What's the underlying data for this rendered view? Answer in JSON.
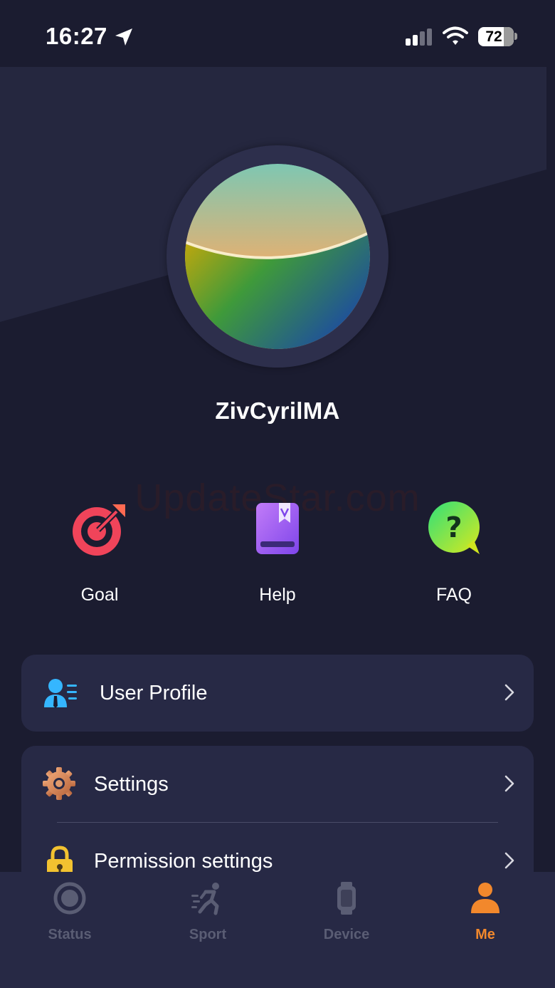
{
  "status_bar": {
    "time": "16:27",
    "battery": "72",
    "icons": [
      "location-arrow-icon",
      "cellular-signal-icon",
      "wifi-icon",
      "battery-icon"
    ]
  },
  "profile": {
    "username": "ZivCyrilMA"
  },
  "watermark": "UpdateStar.com",
  "quick_actions": [
    {
      "label": "Goal",
      "icon": "target-goal-icon"
    },
    {
      "label": "Help",
      "icon": "help-book-icon"
    },
    {
      "label": "FAQ",
      "icon": "faq-question-icon"
    }
  ],
  "menu": {
    "user_profile": {
      "label": "User Profile",
      "icon": "user-profile-icon"
    },
    "settings": {
      "label": "Settings",
      "icon": "gear-icon"
    },
    "permission_settings": {
      "label": "Permission settings",
      "icon": "lock-icon"
    }
  },
  "tabs": [
    {
      "label": "Status",
      "icon": "status-ring-icon",
      "active": false
    },
    {
      "label": "Sport",
      "icon": "running-icon",
      "active": false
    },
    {
      "label": "Device",
      "icon": "watch-icon",
      "active": false
    },
    {
      "label": "Me",
      "icon": "person-icon",
      "active": true
    }
  ],
  "colors": {
    "background": "#1b1c30",
    "header_panel": "#25273f",
    "card": "#272945",
    "accent": "#f2882c",
    "tab_inactive": "#5a5d74"
  }
}
